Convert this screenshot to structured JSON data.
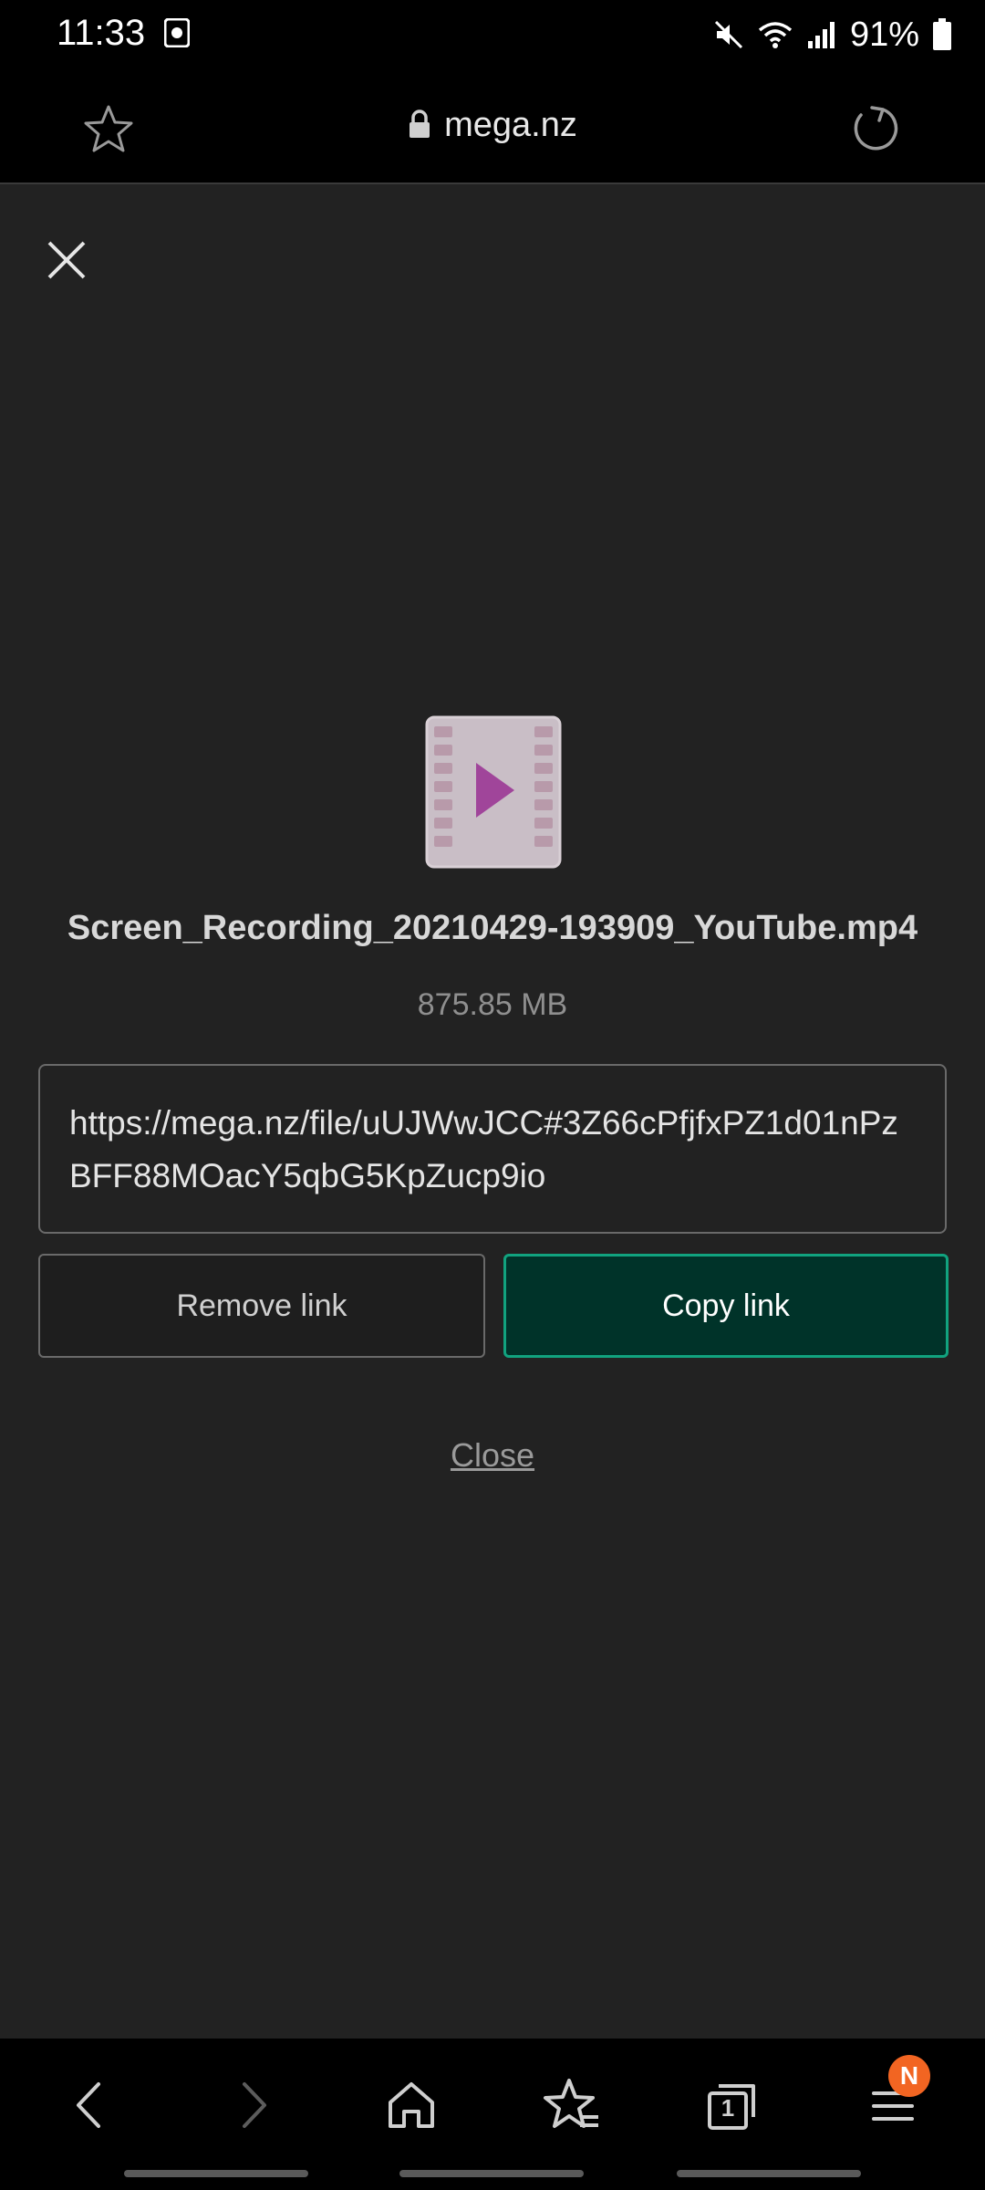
{
  "status_bar": {
    "time": "11:33",
    "battery_percent": "91%",
    "icons": [
      "screen-record-icon",
      "mute-icon",
      "wifi-icon",
      "signal-icon",
      "battery-icon"
    ]
  },
  "browser": {
    "url": "mega.nz",
    "icons": [
      "bookmark-star-icon",
      "lock-icon",
      "reload-icon"
    ]
  },
  "dialog": {
    "file_name": "Screen_Recording_20210429-193909_YouTube.mp4",
    "file_size": "875.85 MB",
    "link": "https://mega.nz/file/uUJWwJCC#3Z66cPfjfxPZ1d01nPzBFF88MOacY5qbG5KpZucp9io",
    "remove_label": "Remove link",
    "copy_label": "Copy link",
    "close_label": "Close"
  },
  "bottom_nav": {
    "items": [
      "back-icon",
      "forward-icon",
      "home-icon",
      "bookmarks-icon",
      "tabs-icon",
      "menu-icon"
    ],
    "tabs_count": "1",
    "badge": "N"
  },
  "colors": {
    "background": "#222222",
    "accent": "#11a37f",
    "copy_button_bg": "#003329",
    "badge": "#f26522",
    "file_icon_play": "#a0459a"
  }
}
